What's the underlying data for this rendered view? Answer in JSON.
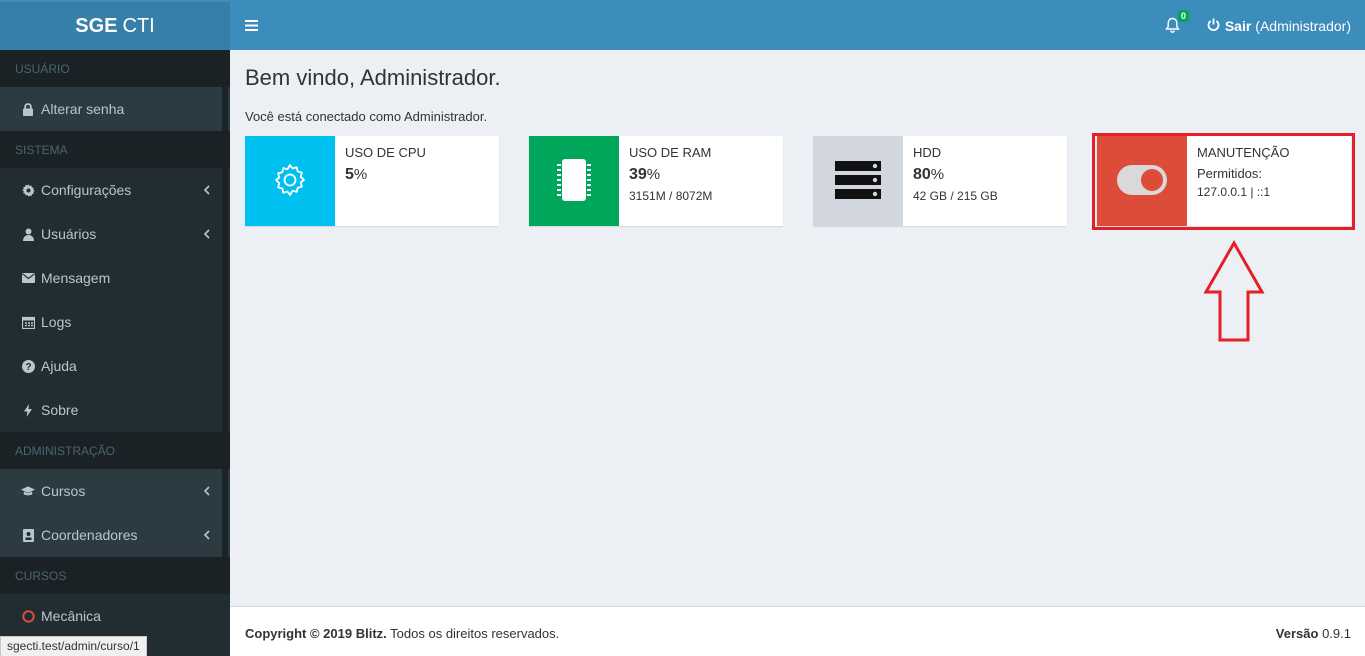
{
  "logo": {
    "bold": "SGE",
    "rest": "CTI"
  },
  "sidebar": {
    "sections": [
      {
        "header": "USUÁRIO"
      },
      {
        "header": "SISTEMA"
      },
      {
        "header": "ADMINISTRAÇÃO"
      },
      {
        "header": "CURSOS"
      }
    ],
    "items": {
      "alterar_senha": "Alterar senha",
      "configuracoes": "Configurações",
      "usuarios": "Usuários",
      "mensagem": "Mensagem",
      "logs": "Logs",
      "ajuda": "Ajuda",
      "sobre": "Sobre",
      "cursos": "Cursos",
      "coordenadores": "Coordenadores",
      "mecanica": "Mecânica"
    }
  },
  "topbar": {
    "notification_count": "0",
    "logout_label": "Sair",
    "logout_user": "(Administrador)"
  },
  "main": {
    "title": "Bem vindo, Administrador.",
    "subtitle": "Você está conectado como Administrador.",
    "boxes": {
      "cpu": {
        "label": "USO DE CPU",
        "value": "5",
        "unit": "%",
        "color": "#00c0ef"
      },
      "ram": {
        "label": "USO DE RAM",
        "value": "39",
        "unit": "%",
        "detail": "3151M / 8072M",
        "color": "#00a65a"
      },
      "hdd": {
        "label": "HDD",
        "value": "80",
        "unit": "%",
        "detail": "42 GB / 215 GB",
        "color": "#d2d6de"
      },
      "maint": {
        "label": "MANUTENÇÃO",
        "line1": "Permitidos:",
        "line2": "127.0.0.1 | ::1",
        "color": "#dd4b39"
      }
    }
  },
  "footer": {
    "copyright_bold": "Copyright © 2019 Blitz.",
    "copyright_rest": "Todos os direitos reservados.",
    "version_label": "Versão",
    "version_value": "0.9.1"
  },
  "statusbar": {
    "url": "sgecti.test/admin/curso/1"
  },
  "colors": {
    "sidebar": "#222d32",
    "topbar": "#3c8dbc",
    "highlight": "#e41f28"
  }
}
